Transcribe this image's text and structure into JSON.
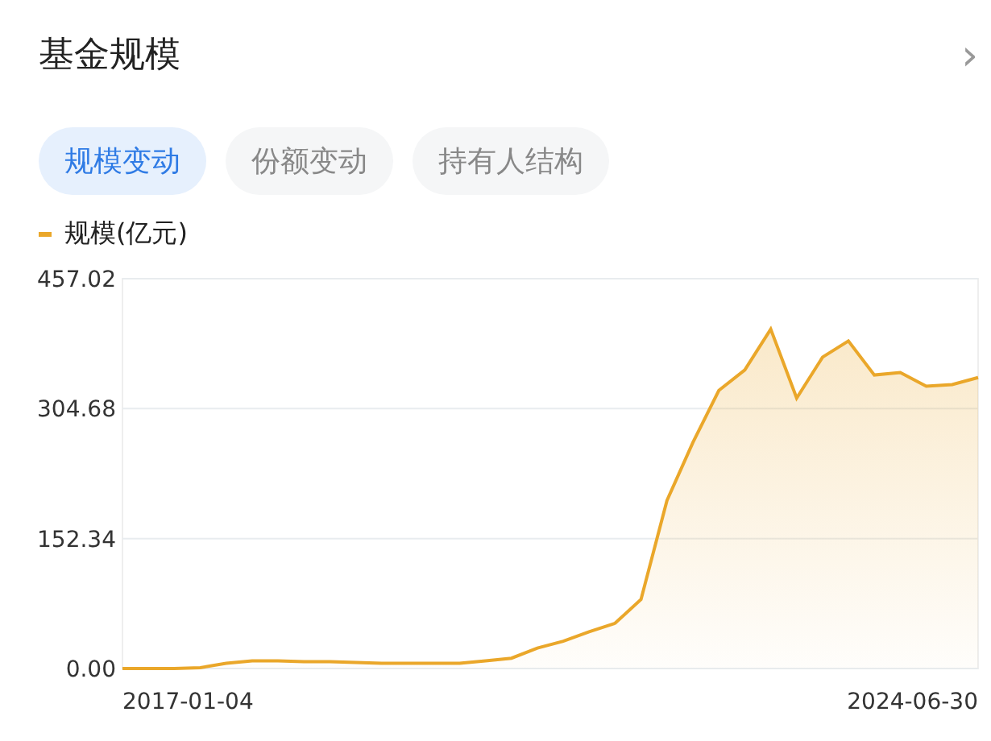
{
  "header": {
    "title": "基金规模",
    "chevron": "›"
  },
  "tabs": [
    {
      "label": "规模变动",
      "selected": true
    },
    {
      "label": "份额变动",
      "selected": false
    },
    {
      "label": "持有人结构",
      "selected": false
    }
  ],
  "chart": {
    "chart_data": {
      "type": "area",
      "ylim": [
        0,
        457.02
      ],
      "yticks": [
        {
          "value": 0,
          "label": "0.00"
        },
        {
          "value": 152.34,
          "label": "152.34"
        },
        {
          "value": 304.68,
          "label": "304.68"
        },
        {
          "value": 457.02,
          "label": "457.02"
        }
      ],
      "series": [
        {
          "name": "规模(亿元)",
          "color": "#eaa72a",
          "values": [
            0,
            0,
            0,
            1,
            6,
            9,
            9,
            8,
            8,
            7,
            6,
            6,
            6,
            6,
            9,
            12,
            24,
            32,
            43,
            53,
            81,
            197,
            265,
            326,
            350,
            398,
            317,
            365,
            384,
            344,
            347,
            331,
            333,
            341
          ]
        }
      ]
    },
    "x_axis_labels": [
      "2017-01-04",
      "2024-06-30"
    ]
  }
}
